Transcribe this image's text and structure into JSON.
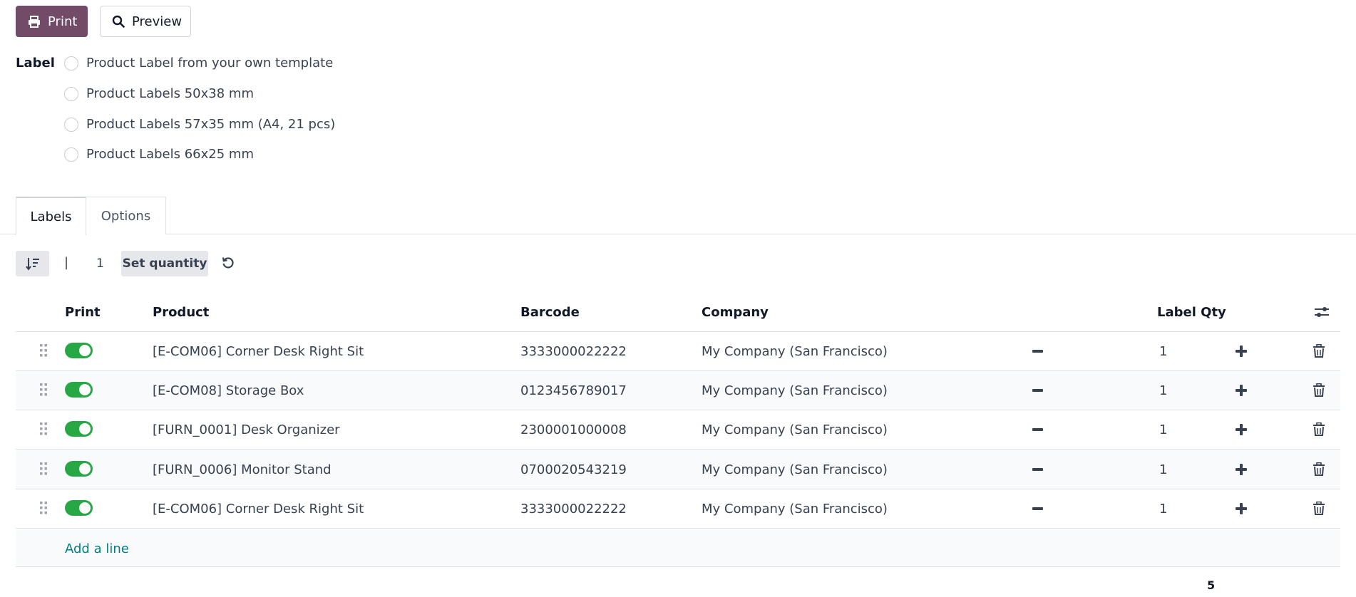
{
  "buttons": {
    "print_label": "Print",
    "preview_label": "Preview"
  },
  "label_section": {
    "title": "Label",
    "options": [
      "Product Label from your own template",
      "Product Labels 50x38 mm",
      "Product Labels 57x35 mm (A4, 21 pcs)",
      "Product Labels 66x25 mm"
    ]
  },
  "tabs": [
    {
      "label": "Labels"
    },
    {
      "label": "Options"
    }
  ],
  "toolbar": {
    "separator": "|",
    "quantity": "1",
    "set_quantity_label": "Set quantity"
  },
  "table": {
    "columns": {
      "print": "Print",
      "product": "Product",
      "barcode": "Barcode",
      "company": "Company",
      "label_qty": "Label Qty"
    },
    "rows": [
      {
        "print": true,
        "product": "[E-COM06] Corner Desk Right Sit",
        "barcode": "3333000022222",
        "company": "My Company (San Francisco)",
        "qty": "1"
      },
      {
        "print": true,
        "product": "[E-COM08] Storage Box",
        "barcode": "0123456789017",
        "company": "My Company (San Francisco)",
        "qty": "1"
      },
      {
        "print": true,
        "product": "[FURN_0001] Desk Organizer",
        "barcode": "2300001000008",
        "company": "My Company (San Francisco)",
        "qty": "1"
      },
      {
        "print": true,
        "product": "[FURN_0006] Monitor Stand",
        "barcode": "0700020543219",
        "company": "My Company (San Francisco)",
        "qty": "1"
      },
      {
        "print": true,
        "product": "[E-COM06] Corner Desk Right Sit",
        "barcode": "3333000022222",
        "company": "My Company (San Francisco)",
        "qty": "1"
      }
    ],
    "add_line_label": "Add a line",
    "total_qty": "5"
  },
  "colors": {
    "primary": "#714B67",
    "toggle_on": "#28a745",
    "link": "#017e84"
  },
  "icons": [
    "printer-icon",
    "search-icon",
    "sort-icon",
    "reset-icon",
    "column-settings-icon",
    "drag-handle-icon",
    "minus-icon",
    "plus-icon",
    "trash-icon"
  ]
}
